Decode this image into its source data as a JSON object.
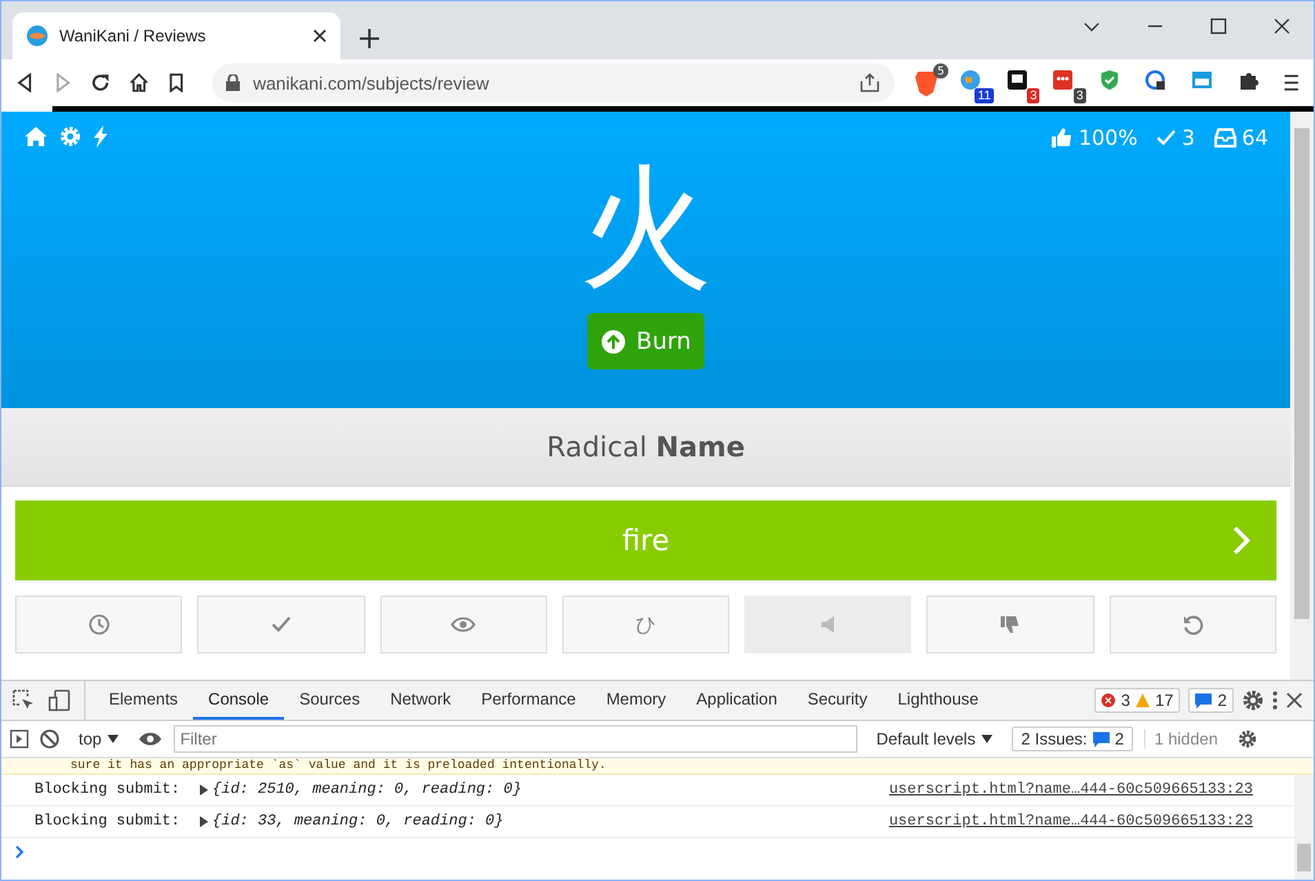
{
  "browser": {
    "tab_title": "WaniKani / Reviews",
    "url": "wanikani.com/subjects/review",
    "shield_count": "5",
    "extension_badges": [
      {
        "kind": "globe",
        "badge": "11",
        "color": "#1a3bd6"
      },
      {
        "kind": "square",
        "badge": "3",
        "color": "#e02525"
      },
      {
        "kind": "dots",
        "badge": "3",
        "color": "#444444"
      },
      {
        "kind": "shield"
      },
      {
        "kind": "lock"
      },
      {
        "kind": "window"
      },
      {
        "kind": "puzzle"
      }
    ]
  },
  "review": {
    "stats": {
      "percent": "100%",
      "done": "3",
      "queue": "64"
    },
    "character": "火",
    "srs": "Burn",
    "question": "Radical **Name**",
    "answer": "fire",
    "buttons": [
      {
        "kind": "clock",
        "disabled": false
      },
      {
        "kind": "check",
        "disabled": false
      },
      {
        "kind": "eye",
        "disabled": false
      },
      {
        "kind": "kana",
        "label": "ひ",
        "disabled": false
      },
      {
        "kind": "audio",
        "disabled": true
      },
      {
        "kind": "thumbdown",
        "disabled": false
      },
      {
        "kind": "undo",
        "disabled": false
      }
    ]
  },
  "devtools": {
    "tabs": [
      {
        "label": "Elements",
        "selected": false
      },
      {
        "label": "Console",
        "selected": true
      },
      {
        "label": "Sources",
        "selected": false
      },
      {
        "label": "Network",
        "selected": false
      },
      {
        "label": "Performance",
        "selected": false
      },
      {
        "label": "Memory",
        "selected": false
      },
      {
        "label": "Application",
        "selected": false
      },
      {
        "label": "Security",
        "selected": false
      },
      {
        "label": "Lighthouse",
        "selected": false
      }
    ],
    "errors": "3",
    "warnings": "17",
    "messages": "2",
    "context": "top",
    "filter_placeholder": "Filter",
    "levels": "Default levels",
    "issues_label": "2 Issues:",
    "issues_count": "2",
    "hidden": "1 hidden",
    "warning_text": "sure it has an appropriate `as` value and it is preloaded intentionally.",
    "entries": [
      {
        "message": "Blocking submit:",
        "object": "{id: 2510, meaning: 0, reading: 0}",
        "source": "userscript.html?name…444-60c509665133:23"
      },
      {
        "message": "Blocking submit:",
        "object": "{id: 33, meaning: 0, reading: 0}",
        "source": "userscript.html?name…444-60c509665133:23"
      }
    ]
  }
}
